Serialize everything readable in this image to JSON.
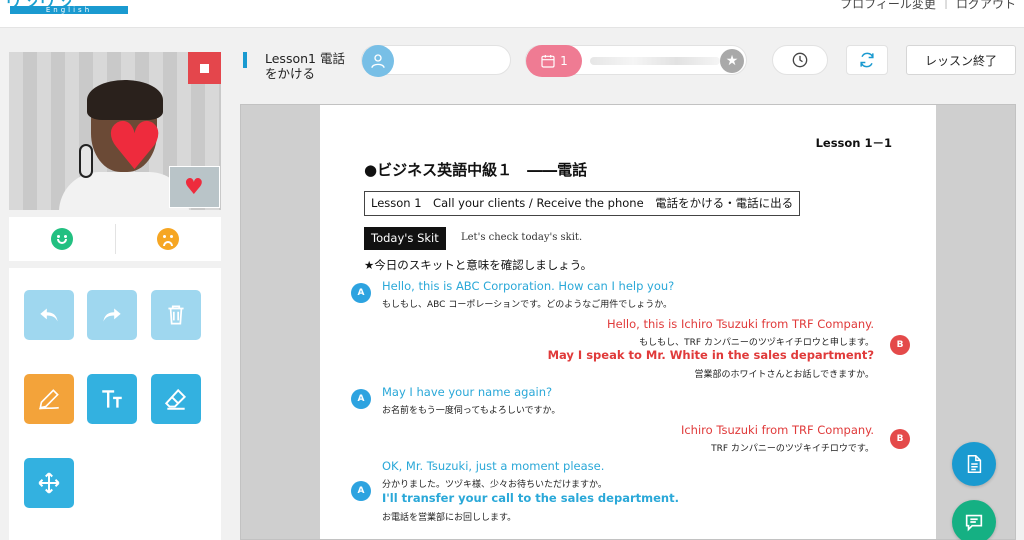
{
  "header": {
    "logo_text": "ワンワン",
    "logo_sub": "English",
    "links": [
      "プロフィール変更",
      "ログアウト"
    ]
  },
  "toolbar": {
    "lesson_title": "Lesson1 電話をかける",
    "calendar_badge": "1",
    "end_button": "レッスン終了"
  },
  "document": {
    "lesson_number": "Lesson 1－1",
    "title": "●ビジネス英語中級１　――電話",
    "lesson_box": "Lesson 1　Call your clients / Receive the phone　電話をかける・電話に出る",
    "skit_label": "Today's Skit",
    "skit_sub": "Let's check today's skit.",
    "instruction": "★今日のスキットと意味を確認しましょう。",
    "dialogue": [
      {
        "speaker": "A",
        "lines": [
          {
            "en": "Hello, this is ABC Corporation. How can I help you?",
            "jp": "もしもし、ABC コーポレーションです。どのようなご用件でしょうか。"
          }
        ]
      },
      {
        "speaker": "B",
        "lines": [
          {
            "en": "Hello, this is Ichiro Tsuzuki from TRF Company.",
            "jp": "もしもし、TRF カンパニーのツヅキイチロウと申します。"
          },
          {
            "en": "May I speak to Mr. White in the sales department?",
            "jp": "営業部のホワイトさんとお話しできますか。"
          }
        ]
      },
      {
        "speaker": "A",
        "lines": [
          {
            "en": "May I have your name again?",
            "jp": "お名前をもう一度伺ってもよろしいですか。"
          }
        ]
      },
      {
        "speaker": "B",
        "lines": [
          {
            "en": "Ichiro Tsuzuki from TRF Company.",
            "jp": "TRF カンパニーのツヅキイチロウです。"
          }
        ]
      },
      {
        "speaker": "A",
        "lines": [
          {
            "en": "OK, Mr. Tsuzuki, just a moment please.",
            "jp": "分かりました。ツヅキ様、少々お待ちいただけますか。"
          },
          {
            "en": "I'll transfer your call to the sales department.",
            "jp": "お電話を営業部にお回しします。"
          }
        ]
      }
    ]
  },
  "tools": [
    "undo-icon",
    "redo-icon",
    "trash-icon",
    "pen-icon",
    "text-icon",
    "eraser-icon",
    "move-icon"
  ],
  "colors": {
    "accent": "#1a9ad0",
    "speaker_a": "#2aa8d8",
    "speaker_b": "#e03a3a",
    "stop": "#e4464c"
  }
}
